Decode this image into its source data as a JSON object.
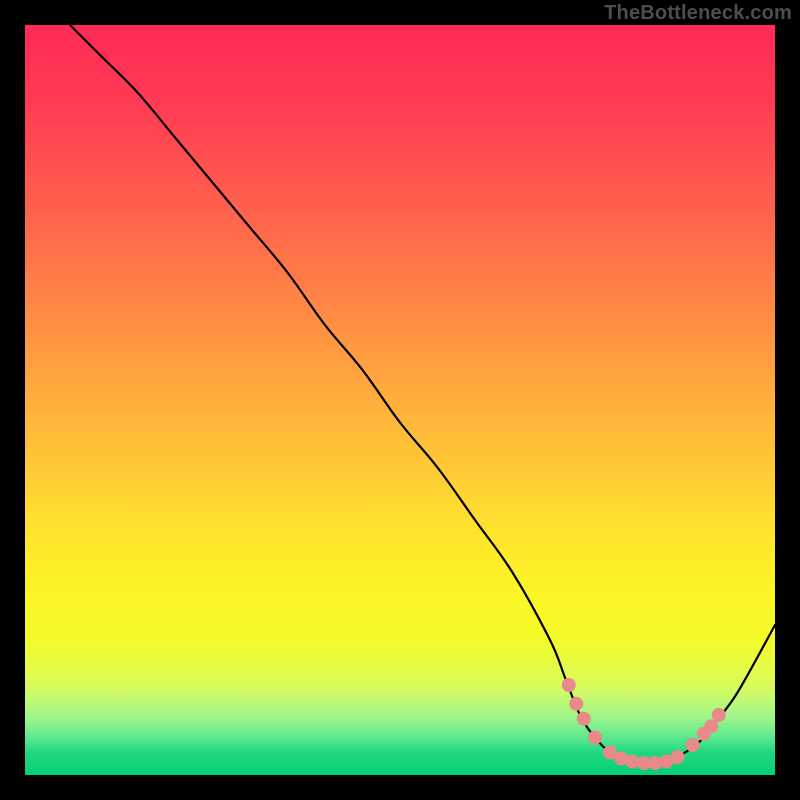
{
  "watermark": "TheBottleneck.com",
  "chart_data": {
    "type": "line",
    "title": "",
    "xlabel": "",
    "ylabel": "",
    "xlim": [
      0,
      100
    ],
    "ylim": [
      0,
      100
    ],
    "curve": {
      "name": "bottleneck-curve",
      "x": [
        6,
        10,
        15,
        20,
        25,
        30,
        35,
        40,
        45,
        50,
        55,
        60,
        65,
        70,
        72,
        74,
        76,
        78,
        80,
        82,
        84,
        86,
        88,
        90,
        92,
        95,
        100
      ],
      "y": [
        100,
        96,
        91,
        85,
        79,
        73,
        67,
        60,
        54,
        47,
        41,
        34,
        27,
        18,
        13,
        8,
        5,
        3,
        2,
        1.5,
        1.5,
        2,
        3,
        4.5,
        7,
        11,
        20
      ]
    },
    "markers": {
      "name": "highlight-dots",
      "color": "#e88a8a",
      "points": [
        {
          "x": 72.5,
          "y": 12
        },
        {
          "x": 73.5,
          "y": 9.5
        },
        {
          "x": 74.5,
          "y": 7.5
        },
        {
          "x": 76.0,
          "y": 5
        },
        {
          "x": 78.0,
          "y": 3
        },
        {
          "x": 79.5,
          "y": 2.2
        },
        {
          "x": 81.0,
          "y": 1.8
        },
        {
          "x": 82.5,
          "y": 1.6
        },
        {
          "x": 84.0,
          "y": 1.6
        },
        {
          "x": 85.5,
          "y": 1.8
        },
        {
          "x": 87.0,
          "y": 2.4
        },
        {
          "x": 89.0,
          "y": 4.0
        },
        {
          "x": 90.5,
          "y": 5.5
        },
        {
          "x": 91.5,
          "y": 6.5
        },
        {
          "x": 92.5,
          "y": 8.0
        }
      ]
    },
    "gradient_note": "vertical red-to-green heatmap background",
    "grid": false,
    "legend": null
  }
}
